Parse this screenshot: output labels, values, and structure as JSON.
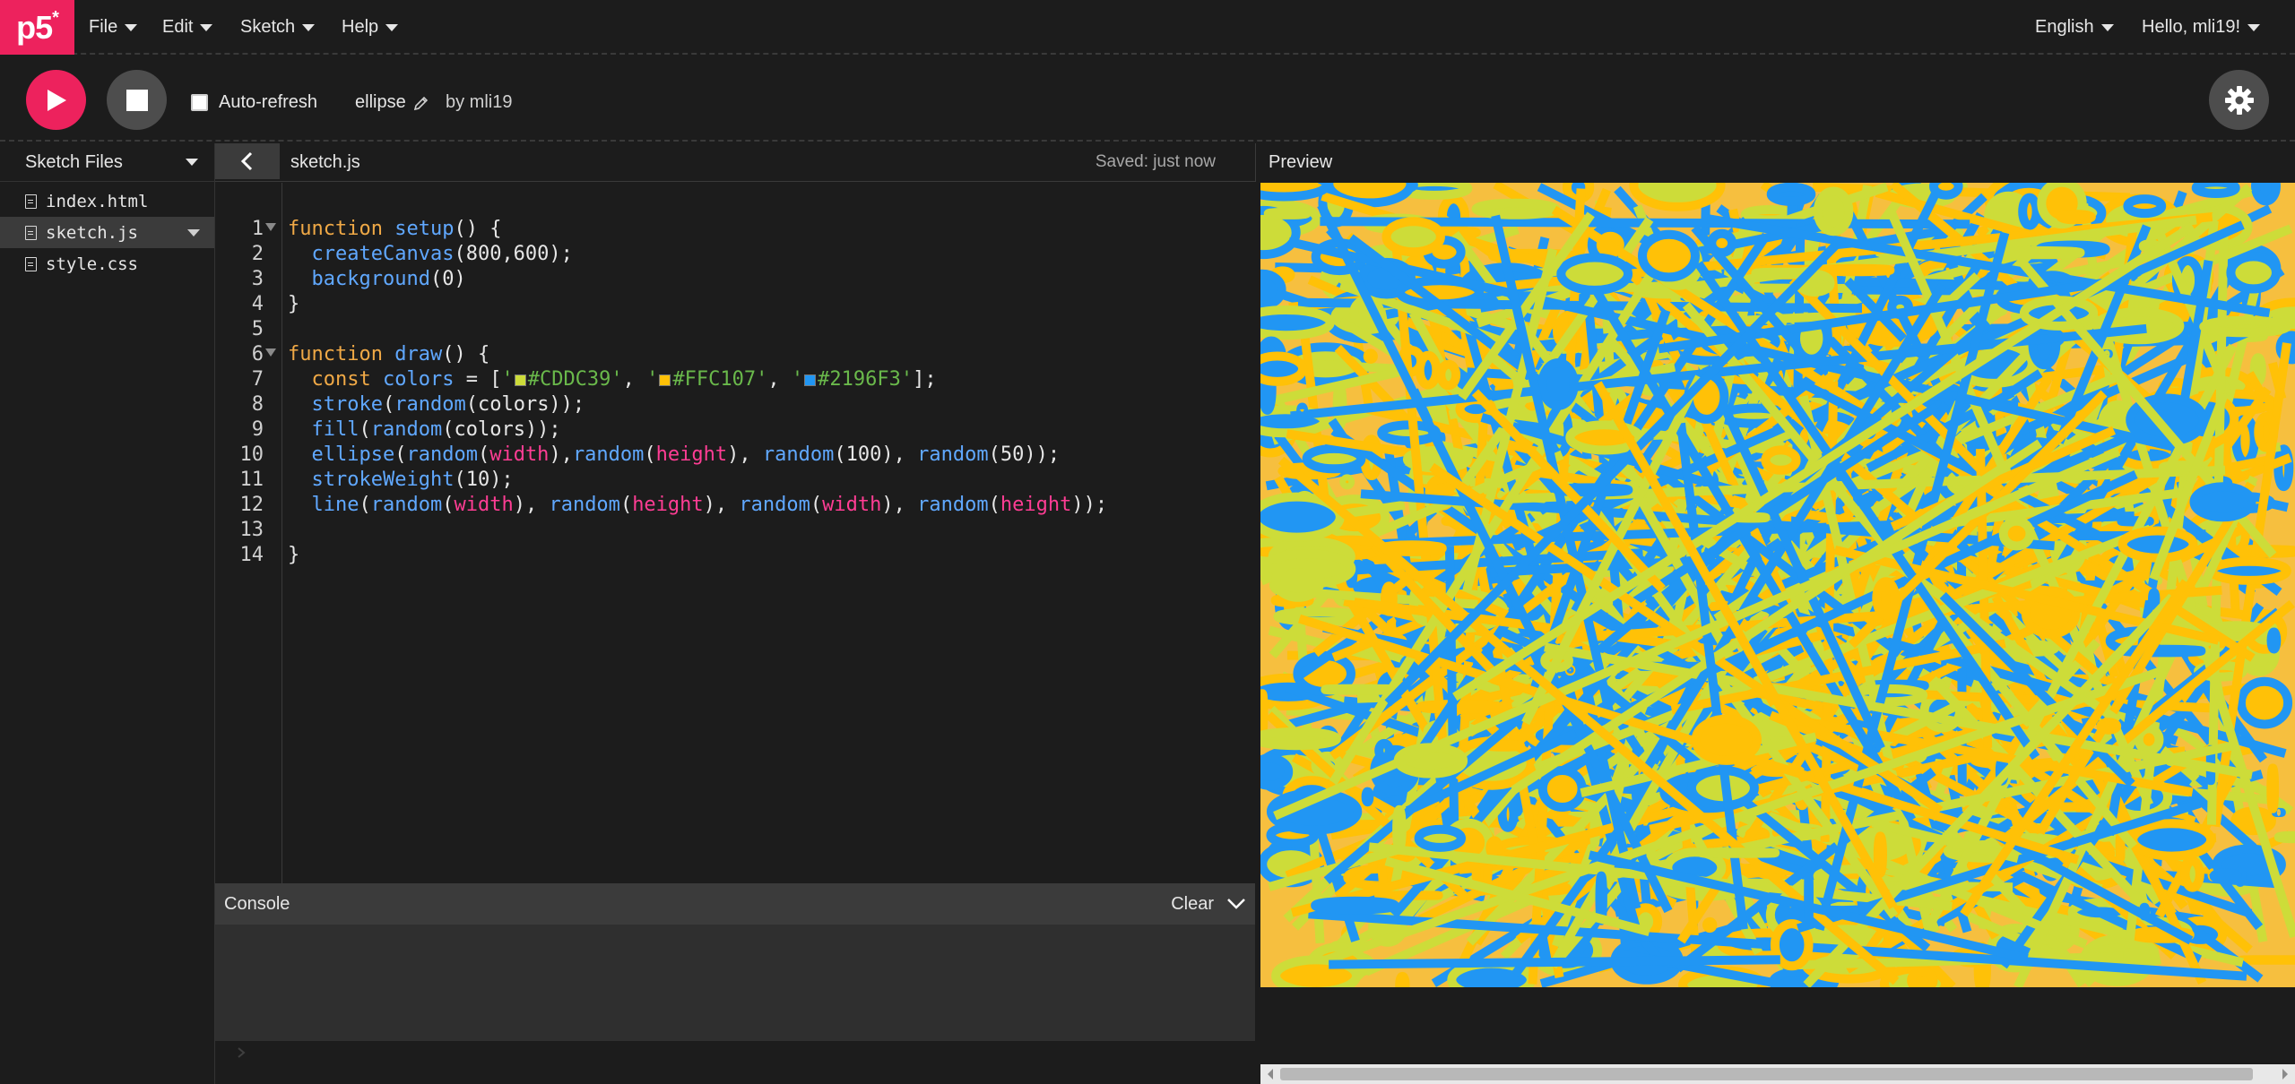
{
  "nav": {
    "logo_text": "p5",
    "logo_sup": "*",
    "menus": [
      "File",
      "Edit",
      "Sketch",
      "Help"
    ],
    "language": "English",
    "user": "Hello, mli19!"
  },
  "toolbar": {
    "autorefresh_label": "Auto-refresh",
    "sketch_name": "ellipse",
    "owner": "by mli19"
  },
  "sidebar": {
    "title": "Sketch Files",
    "files": [
      "index.html",
      "sketch.js",
      "style.css"
    ],
    "selected": "sketch.js"
  },
  "editor": {
    "tab": "sketch.js",
    "saved_status": "Saved: just now",
    "line_numbers": [
      "1",
      "2",
      "3",
      "4",
      "5",
      "6",
      "7",
      "8",
      "9",
      "10",
      "11",
      "12",
      "13",
      "14"
    ]
  },
  "console": {
    "title": "Console",
    "clear_label": "Clear"
  },
  "preview": {
    "title": "Preview"
  },
  "colors": {
    "accent": "#ed225d",
    "sketch_palette": [
      "#CDDC39",
      "#FFC107",
      "#2196F3"
    ],
    "background": "#1c1c1c"
  },
  "code_tokens": {
    "kw_function": "function",
    "kw_const": "const",
    "fn_setup": "setup",
    "fn_draw": "draw",
    "fn_createCanvas": "createCanvas",
    "fn_background": "background",
    "fn_stroke": "stroke",
    "fn_fill": "fill",
    "fn_ellipse": "ellipse",
    "fn_random": "random",
    "fn_strokeWeight": "strokeWeight",
    "fn_line": "line",
    "var_colors": "colors",
    "const_width": "width",
    "const_height": "height",
    "str_c1": "#CDDC39",
    "str_c2": "#FFC107",
    "str_c3": "#2196F3"
  }
}
